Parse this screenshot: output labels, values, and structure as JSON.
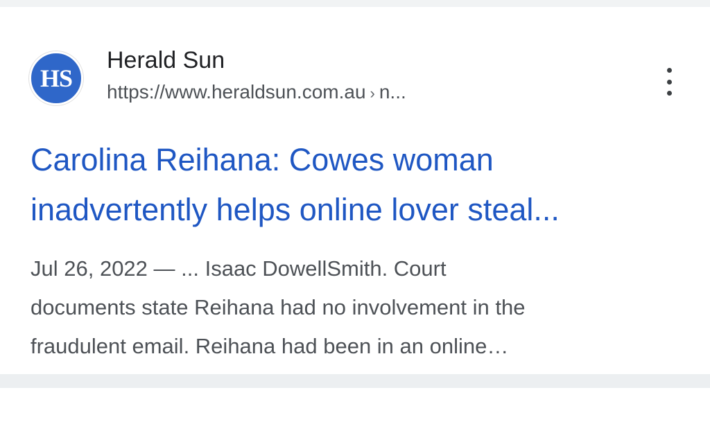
{
  "result": {
    "favicon_text": "HS",
    "site_name": "Herald Sun",
    "url": "https://www.heraldsun.com.au",
    "url_separator": "›",
    "url_path": "n...",
    "title_line1": "Carolina Reihana: Cowes woman",
    "title_line2": "inadvertently helps online lover steal...",
    "snippet_line1": "Jul 26, 2022 — ... Isaac DowellSmith. Court",
    "snippet_line2": "documents state Reihana had no involvement in the",
    "snippet_line3": "fraudulent email. Reihana had been in an online…",
    "more_icon": "more-vertical-icon",
    "colors": {
      "title": "#1f57c3",
      "favicon_bg": "#2f67c9",
      "text": "#4d5156"
    }
  }
}
